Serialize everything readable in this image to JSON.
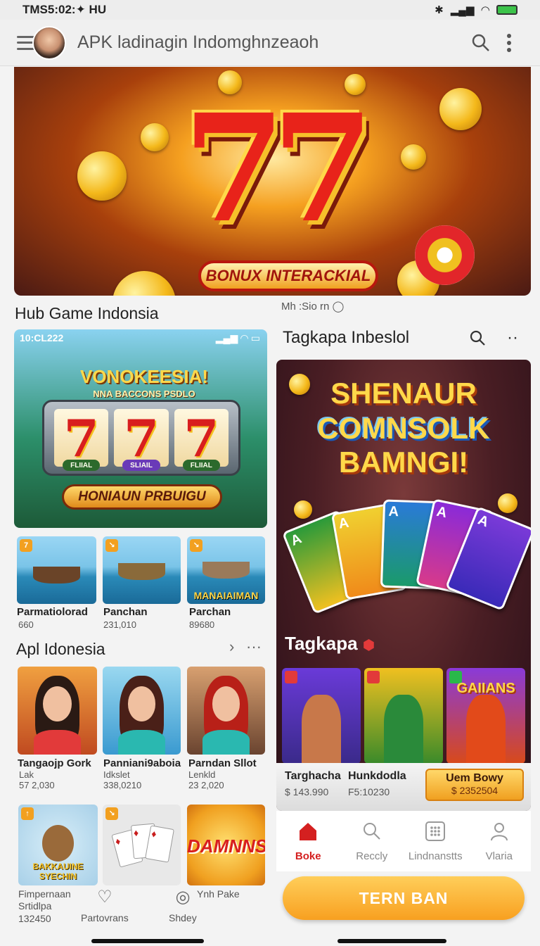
{
  "status": {
    "time": "TMS5:02:✦ HU"
  },
  "app_bar": {
    "title": "APK ladinagin Indomghnzeaoh"
  },
  "hero": {
    "banner": "BONUX INTERACKIAL",
    "number": "77"
  },
  "sections": {
    "hub_title": "Hub Game Indonsia",
    "hub_meta": "Mh :Sio rn",
    "apl_title": "Apl Idonesia"
  },
  "left_card": {
    "status_time": "10:CL222",
    "title": "VONOKEESIA!",
    "subtitle": "NNA BACCONS PSDLO",
    "reels": [
      "7",
      "7",
      "7"
    ],
    "reel_tags": [
      "FLIIAL",
      "SLIAIL",
      "FLIIAL"
    ],
    "button": "HONIAUN PRBUIGU"
  },
  "fish_row": [
    {
      "name": "Parmatiolorad",
      "sub": "660",
      "caption": ""
    },
    {
      "name": "Panchan",
      "sub": "231,010",
      "caption": ""
    },
    {
      "name": "Parchan",
      "sub": "89680",
      "caption": "MANAIAIMAN"
    }
  ],
  "apl_row": [
    {
      "name": "Tangaojp Gork",
      "sub1": "Lak",
      "sub2": "57 2,030"
    },
    {
      "name": "Panniani9aboia",
      "sub1": "Idkslet",
      "sub2": "338,0210"
    },
    {
      "name": "Parndan Sllot",
      "sub1": "Lenkld",
      "sub2": "23 2,020"
    }
  ],
  "bottom_tiles": [
    {
      "label": "BAKKAUINE SYECHIN"
    },
    {
      "label": ""
    },
    {
      "label": "DAMNNS"
    }
  ],
  "bottom_left": {
    "item1_line1": "Fimpernaan",
    "item1_line2": "Srtidlpa",
    "item1_line3": "132450",
    "item2": "Partovrans",
    "item3": "Shdey",
    "item4": "Ynh Pake"
  },
  "right_panel": {
    "header": "Tagkapa Inbeslol",
    "title1": "SHENAUR",
    "title2": "COMNSOLK",
    "title3": "BAMNGI!",
    "label": "Tagkapa",
    "mini_games": [
      "",
      "",
      "GAIIANS"
    ],
    "strip": {
      "item1_name": "Targhacha",
      "item1_sub": "$ 143.990",
      "item2_name": "Hunkdodla",
      "item2_sub": "F5:10230",
      "btn_title": "Uem Bowy",
      "btn_price": "$ 2352504"
    }
  },
  "bottom_nav": [
    {
      "label": "Boke",
      "icon": "home-icon",
      "active": true
    },
    {
      "label": "Reccly",
      "icon": "search-icon",
      "active": false
    },
    {
      "label": "Lindnanstts",
      "icon": "grid-icon",
      "active": false
    },
    {
      "label": "Vlaria",
      "icon": "person-icon",
      "active": false
    }
  ],
  "cta": {
    "label": "TERN BAN"
  }
}
